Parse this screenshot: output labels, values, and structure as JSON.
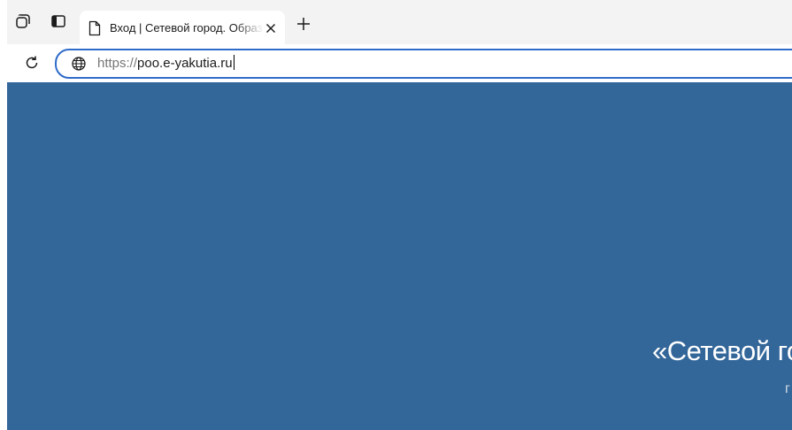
{
  "browser": {
    "tab": {
      "title": "Вход | Сетевой город. Образование",
      "close_icon": "close-icon",
      "page_icon": "document-icon"
    },
    "tab_actions_icon": "tab-actions-icon",
    "vertical_tabs_icon": "vertical-tabs-icon",
    "new_tab_icon": "plus-icon",
    "reload_icon": "reload-icon",
    "address": {
      "scheme": "https://",
      "host": "poo.e-yakutia.ru",
      "site_icon": "globe-icon"
    }
  },
  "page": {
    "background_color": "#336699",
    "hero_title": "«Сетевой го",
    "hero_subtitle": "г"
  }
}
